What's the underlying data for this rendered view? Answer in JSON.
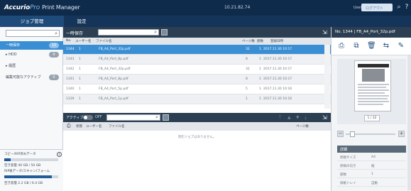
{
  "topbar": {
    "brand_a": "Accurio",
    "brand_b": "Pro",
    "brand_c": "Print Manager",
    "ip": "10.21.82.74",
    "user_label": "User",
    "user_value": "ログアウト"
  },
  "tabs": [
    {
      "label": "ジョブ管理"
    },
    {
      "label": "設定"
    }
  ],
  "left": {
    "items": [
      {
        "label": "一時保存",
        "count": "10"
      },
      {
        "label": "▸ HDD",
        "count": "0"
      },
      {
        "label": "▸ 履歴",
        "count": ""
      },
      {
        "label": "編集可能なアクティブ",
        "count": "0"
      }
    ],
    "bottom": {
      "title": "コピー/RIP済みデータ",
      "line1": "空き容量 40 GB / 50 GB",
      "line2": "RIP後データ/スキャン/フォーム",
      "line3": "空き容量 2.2 GB / 6.4 GB",
      "bar1": 0.12,
      "bar2": 0.88
    }
  },
  "main": {
    "title": "一時保存",
    "columns": [
      "No.",
      "ユーザー名",
      "ファイル名",
      "ページ数",
      "部数",
      "登録日時"
    ],
    "rows": [
      {
        "no": "1344",
        "user": "1",
        "file": "FB_A4_Port_32p.pdf",
        "pages": "32",
        "copies": "1",
        "date": "2017.11.30 10:17"
      },
      {
        "no": "1343",
        "user": "1",
        "file": "FB_A4_Port_8p.pdf",
        "pages": "8",
        "copies": "1",
        "date": "2017.11.30 10:17"
      },
      {
        "no": "1342",
        "user": "1",
        "file": "FB_A4_Port_32p.pdf",
        "pages": "32",
        "copies": "1",
        "date": "2017.11.30 10:17"
      },
      {
        "no": "1341",
        "user": "1",
        "file": "FB_A4_Port_8p.pdf",
        "pages": "8",
        "copies": "1",
        "date": "2017.11.30 10:17"
      },
      {
        "no": "1340",
        "user": "1",
        "file": "FB_A4_Port_5p.pdf",
        "pages": "5",
        "copies": "1",
        "date": "2017.11.30 10:16"
      },
      {
        "no": "1339",
        "user": "1",
        "file": "FB_A4_Port_1p.pdf",
        "pages": "1",
        "copies": "1",
        "date": "2017.11.30 10:16"
      }
    ],
    "active_title": "アクティブ",
    "toggle_label": "OFF",
    "columns2": [
      "状態",
      "ユーザー名",
      "ファイル名",
      "ページ数"
    ],
    "empty_text": "現在ジョブはありません。"
  },
  "right": {
    "title": "No. 1344 | FB_A4_Port_32p.pdf",
    "page_label": "1 / 32",
    "props_title": "詳細",
    "props": [
      {
        "k": "原稿サイズ",
        "v": "A4"
      },
      {
        "k": "原稿の向き",
        "v": "縦"
      },
      {
        "k": "部数",
        "v": "1"
      },
      {
        "k": "排紙トレイ",
        "v": "自動"
      }
    ]
  },
  "icons": [
    "search-icon",
    "info-icon",
    "help-icon",
    "print-icon",
    "copy-icon",
    "delete-icon",
    "send-icon",
    "edit-icon",
    "collapse-icon",
    "zoom-in-icon",
    "zoom-out-icon"
  ]
}
